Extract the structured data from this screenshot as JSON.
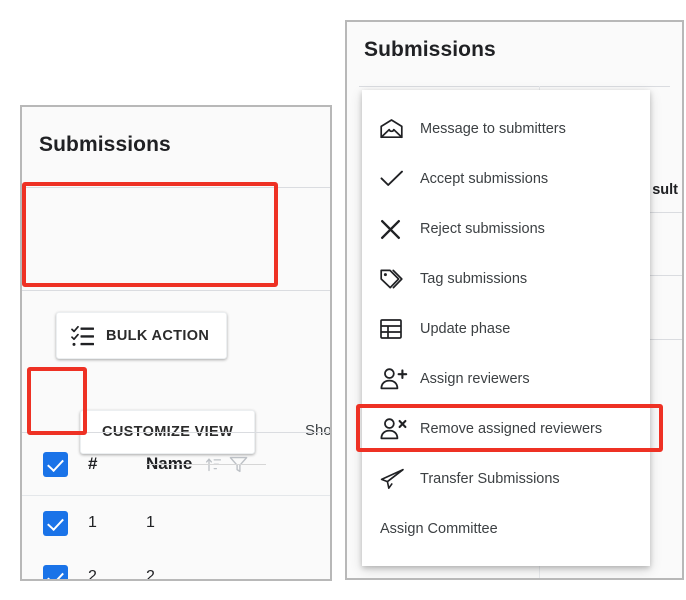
{
  "left_panel": {
    "title": "Submissions",
    "bulk_action_button": {
      "label": "BULK ACTION",
      "icon": "playlist-add-check-icon"
    },
    "customize_view_button": {
      "label": "CUSTOMIZE VIEW"
    },
    "show_partial_text": "Sho",
    "table": {
      "headers": {
        "number": "#",
        "name": "Name"
      },
      "header_icons": [
        "sort-icon",
        "filter-funnel-icon"
      ],
      "header_checkbox_checked": true,
      "rows": [
        {
          "checked": true,
          "number": "1",
          "name": "1"
        },
        {
          "checked": true,
          "number": "2",
          "name": "2"
        }
      ]
    }
  },
  "right_panel": {
    "title": "Submissions",
    "result_partial_text": "sult",
    "menu": {
      "items": [
        {
          "label": "Message to submitters",
          "icon": "envelope-icon"
        },
        {
          "label": "Accept submissions",
          "icon": "check-icon"
        },
        {
          "label": "Reject submissions",
          "icon": "close-x-icon"
        },
        {
          "label": "Tag submissions",
          "icon": "tag-icon"
        },
        {
          "label": "Update phase",
          "icon": "table-grid-icon"
        },
        {
          "label": "Assign reviewers",
          "icon": "person-add-icon"
        },
        {
          "label": "Remove assigned reviewers",
          "icon": "person-remove-icon"
        },
        {
          "label": "Transfer Submissions",
          "icon": "paper-plane-icon"
        },
        {
          "label": "Assign Committee",
          "icon": "none"
        }
      ]
    }
  },
  "annotations": {
    "color": "#ee3124",
    "boxes": [
      {
        "target": "bulk-action-button"
      },
      {
        "target": "header-checkbox"
      },
      {
        "target": "remove-assigned-reviewers-menu-item"
      }
    ]
  }
}
